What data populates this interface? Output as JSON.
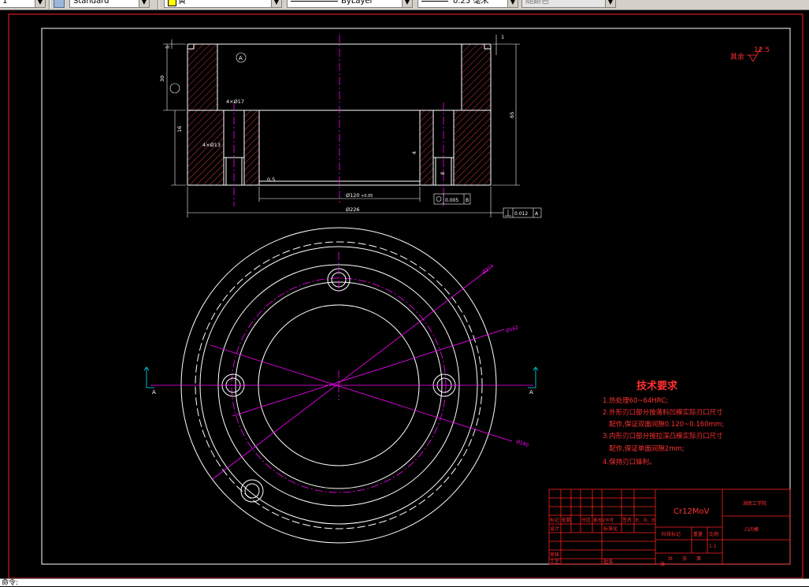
{
  "toolbar": {
    "first_value": "1",
    "text_style": "Standard",
    "color": "黄",
    "color_swatch": "#ffff00",
    "linetype": "ByLayer",
    "lineweight": "0.25 毫米",
    "plot_style": "随颜色"
  },
  "drawing": {
    "section_label": "A",
    "dims": {
      "d_4x17": "4×Ø17",
      "d_4x13": "4×Ø13",
      "d_120": "Ø120",
      "d_226": "Ø226",
      "d_120_tol": "+0.05",
      "h_30": "30",
      "h_16": "16",
      "h_65": "65",
      "h_5": "5",
      "h_1": "1",
      "h_8": "8",
      "r_4": "4",
      "c_05": "0.5",
      "flat_005": "0.005",
      "datum_b": "B",
      "perp_tol": "0.012",
      "datum_a": "A",
      "d_204": "Ø204",
      "d_162": "Ø162",
      "d_180": "Ø180"
    },
    "roughness": {
      "label": "其余",
      "value": "12.5"
    },
    "view_marks": {
      "left": "A",
      "right": "A"
    },
    "tech": {
      "title": "技术要求",
      "lines": [
        "1.热处理60~64HRC;",
        "2.外形刃口部分按落料凹模实际刃口尺寸",
        "   配作,保证双面间隙0.120~0.160mm;",
        "3.内形刃口部分按拉深凸模实际刃口尺寸",
        "   配作,保证单面间隙2mm;",
        "4.保持刃口锋利。"
      ]
    },
    "title_block": {
      "material": "Cr12MoV",
      "school": "湖南工学院",
      "part_name": "凸凹模",
      "labels": {
        "biaoji": "标记",
        "chushu": "处数",
        "fenqu": "分区",
        "gengwen": "更改文件号",
        "qianming": "签名",
        "nyr": "年、月、日",
        "sheji": "设计",
        "biaozhunhua": "标准化",
        "jieduan": "阶段标记",
        "zhongliang": "重量",
        "bili": "比例",
        "shenhe": "审核",
        "gongyi": "工艺",
        "pizhun": "批准",
        "gong": "共",
        "zhang": "张",
        "di": "第"
      },
      "scale": "1:1"
    }
  },
  "command_line": "命令:"
}
